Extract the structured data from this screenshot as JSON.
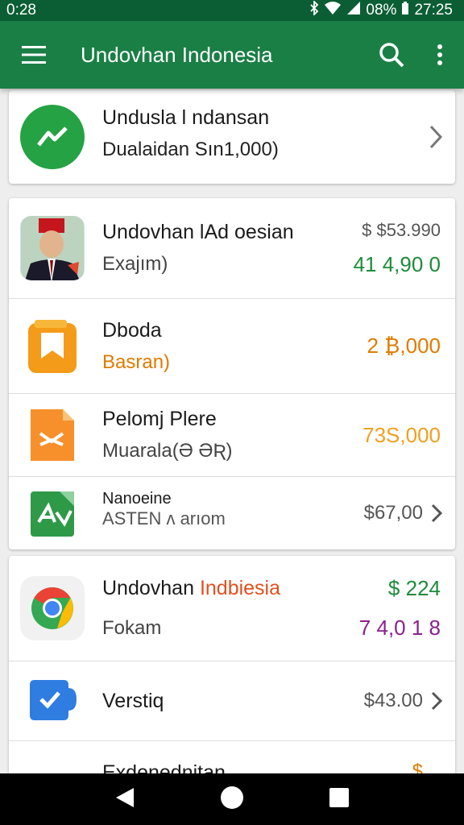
{
  "status_bar": {
    "time_left": "0:28",
    "battery": "08%",
    "time_right": "27:25"
  },
  "app_bar": {
    "title": "Undovhan Indonesia"
  },
  "top_card": {
    "name": "Undusla l ndansan",
    "sub": "Dualaidan Sın1,000)"
  },
  "group1": [
    {
      "name": "Undovhan lAd oesian",
      "sub": "Exajım)",
      "amount_top": "$ $53.990",
      "amount": "41 4,90 0",
      "amount_color": "#1e8c3a",
      "icon": "portrait-icon"
    },
    {
      "name": "Dboda",
      "sub": "Basran)",
      "sub_color": "#e07b00",
      "amount": "2 ₿,000",
      "amount_color": "#e07b00",
      "icon": "bookmark-icon"
    },
    {
      "name": "Pelomj Plere",
      "sub": "Muarala(Ə ƏƦ)",
      "amount": "73S,000",
      "amount_color": "#f0a020",
      "icon": "document-fold-icon"
    },
    {
      "name": "Nanoeine",
      "sub": "ASTEN ʌ arıom",
      "amount": "$67,00",
      "amount_color": "#555555",
      "icon": "green-file-icon"
    }
  ],
  "group2": [
    {
      "name_a": "Undovhan ",
      "name_b": "Indbiesia",
      "name_b_color": "#e05020",
      "sub": "Fokam",
      "amount_top": "$ 224",
      "amount_top_color": "#1e8c3a",
      "amount": "7 4,0 1 8",
      "amount_color": "#8a2090",
      "icon": "chrome-icon"
    },
    {
      "name": "Verstiq",
      "amount": "$43.00",
      "amount_color": "#555555",
      "icon": "chat-check-icon"
    },
    {
      "name": "Exdenednitan",
      "amount": "$",
      "amount_color": "#e07b00",
      "icon": "pink-icon"
    }
  ],
  "colors": {
    "primary": "#1a7f45",
    "primary_dark": "#0b5e34"
  }
}
